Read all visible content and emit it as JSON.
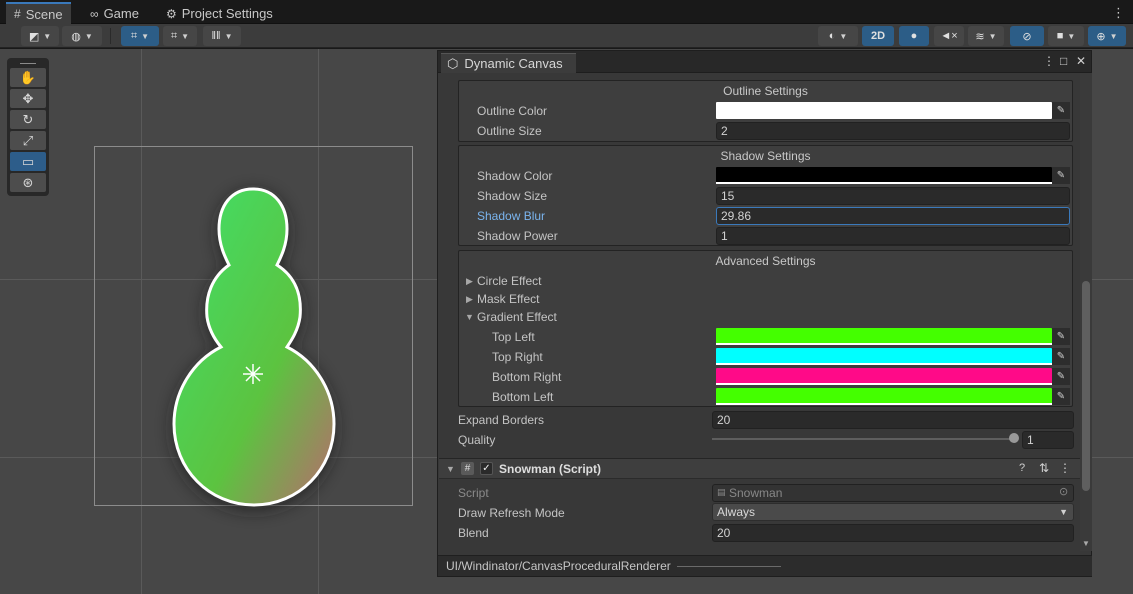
{
  "tabs": [
    {
      "icon": "#",
      "label": "Scene",
      "active": true
    },
    {
      "icon": "∞",
      "label": "Game",
      "active": false
    },
    {
      "icon": "⚙",
      "label": "Project Settings",
      "active": false
    }
  ],
  "toolbar": {
    "mode_2d": "2D"
  },
  "inspector": {
    "title": "Dynamic Canvas",
    "outline": {
      "title": "Outline Settings",
      "color_label": "Outline Color",
      "color": "#ffffff",
      "size_label": "Outline Size",
      "size": "2"
    },
    "shadow": {
      "title": "Shadow Settings",
      "color_label": "Shadow Color",
      "color": "#000000",
      "size_label": "Shadow Size",
      "size": "15",
      "blur_label": "Shadow Blur",
      "blur": "29.86",
      "power_label": "Shadow Power",
      "power": "1"
    },
    "advanced": {
      "title": "Advanced Settings",
      "circle_effect": "Circle Effect",
      "mask_effect": "Mask Effect",
      "gradient_effect": "Gradient Effect",
      "top_left_label": "Top Left",
      "top_left": "#44ff00",
      "top_right_label": "Top Right",
      "top_right": "#00ffff",
      "bottom_right_label": "Bottom Right",
      "bottom_right": "#ff0a88",
      "bottom_left_label": "Bottom Left",
      "bottom_left": "#44ff00"
    },
    "expand_borders_label": "Expand Borders",
    "expand_borders": "20",
    "quality_label": "Quality",
    "quality": "1",
    "component": {
      "title": "Snowman (Script)",
      "script_label": "Script",
      "script": "Snowman",
      "draw_refresh_label": "Draw Refresh Mode",
      "draw_refresh": "Always",
      "blend_label": "Blend",
      "blend": "20"
    },
    "footer": "UI/Windinator/CanvasProceduralRenderer"
  }
}
